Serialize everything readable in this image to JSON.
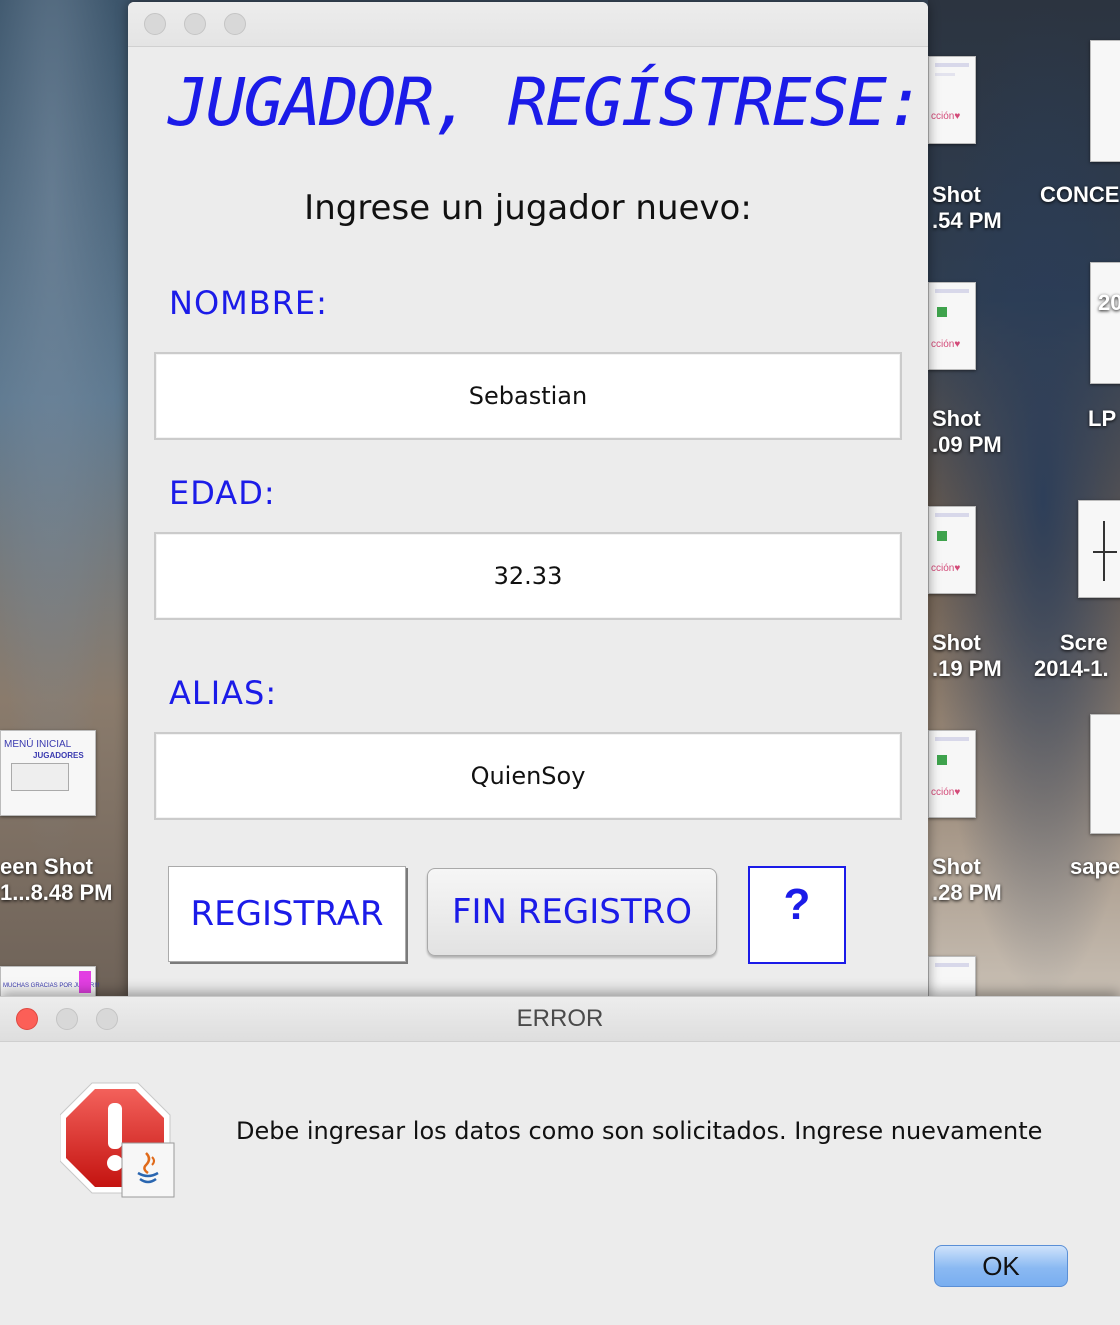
{
  "desktop": {
    "icons": [
      {
        "line1": "Shot",
        "line2": ".54 PM"
      },
      {
        "line1": "CONCE",
        "line2": ""
      },
      {
        "line1": "Shot",
        "line2": ".09 PM"
      },
      {
        "line1": "LP",
        "line2": ""
      },
      {
        "line1": "20",
        "line2": ""
      },
      {
        "line1": "Shot",
        "line2": ".19 PM"
      },
      {
        "line1": "Scre",
        "line2": "2014-1."
      },
      {
        "line1": "Shot",
        "line2": ".28 PM"
      },
      {
        "line1": "sape",
        "line2": ""
      },
      {
        "line1": "een Shot",
        "line2": "1...8.48 PM"
      }
    ],
    "thumb_menu_title": "MENÚ INICIAL",
    "thumb_menu_sub": "JUGADORES",
    "thumb_thanks": "MUCHAS GRACIAS POR JUGAR!!!",
    "thumb_cancion": "cción♥"
  },
  "main_window": {
    "heading": "JUGADOR,  REGÍSTRESE:",
    "subheading": "Ingrese un jugador nuevo:",
    "fields": [
      {
        "label": "NOMBRE:",
        "value": "Sebastian"
      },
      {
        "label": "EDAD:",
        "value": "32.33"
      },
      {
        "label": "ALIAS:",
        "value": "QuienSoy"
      }
    ],
    "buttons": {
      "register": "REGISTRAR",
      "finish": "FIN REGISTRO",
      "help": "?"
    }
  },
  "error_dialog": {
    "title": "ERROR",
    "message": "Debe ingresar los datos como son solicitados. Ingrese nuevamente",
    "ok_label": "OK"
  },
  "colors": {
    "accent_blue": "#1b1be8",
    "error_red": "#d9201c",
    "ok_button": "#8ab9f2"
  }
}
